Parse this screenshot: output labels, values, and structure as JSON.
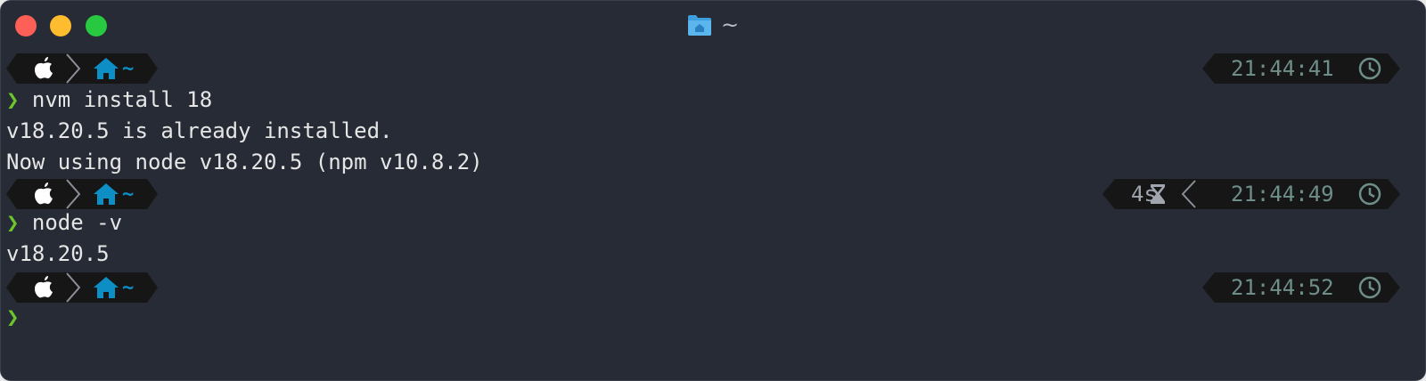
{
  "window": {
    "title": "~",
    "title_icon": "home-folder-icon",
    "controls": [
      "close",
      "minimize",
      "zoom"
    ]
  },
  "colors": {
    "background": "#262b35",
    "prompt_arrow": "#6ac62c",
    "home_icon": "#0d8fc6",
    "time_text": "#6e8e8a",
    "segment_bg": "#161616"
  },
  "prompts": [
    {
      "segment": {
        "os_icon": "apple-icon",
        "dir_icon": "home-icon",
        "dir": "~"
      },
      "right": {
        "time": "21:44:41",
        "duration": ""
      },
      "arrow": "❯",
      "command": "nvm install 18",
      "output": [
        "v18.20.5 is already installed.",
        "Now using node v18.20.5 (npm v10.8.2)"
      ]
    },
    {
      "segment": {
        "os_icon": "apple-icon",
        "dir_icon": "home-icon",
        "dir": "~"
      },
      "right": {
        "time": "21:44:49",
        "duration": "4s"
      },
      "arrow": "❯",
      "command": "node -v",
      "output": [
        "v18.20.5"
      ]
    },
    {
      "segment": {
        "os_icon": "apple-icon",
        "dir_icon": "home-icon",
        "dir": "~"
      },
      "right": {
        "time": "21:44:52",
        "duration": ""
      },
      "arrow": "❯",
      "command": "",
      "output": []
    }
  ]
}
